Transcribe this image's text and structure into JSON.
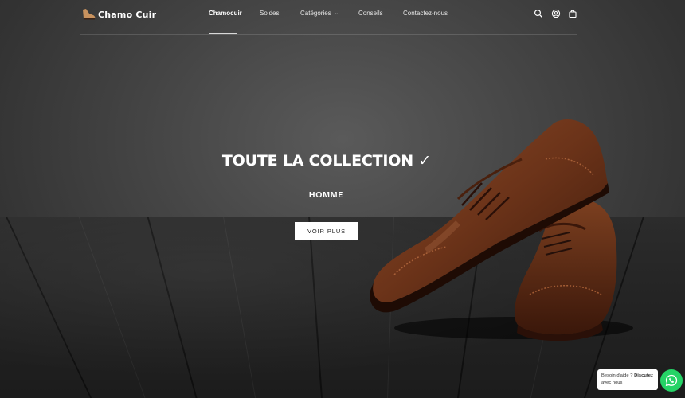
{
  "brand": {
    "name": "Chamo Cuir"
  },
  "nav": {
    "items": [
      {
        "label": "Chamocuir",
        "active": true
      },
      {
        "label": "Soldes"
      },
      {
        "label": "Catégories",
        "has_dropdown": true
      },
      {
        "label": "Conseils"
      },
      {
        "label": "Contactez-nous"
      }
    ],
    "icons": [
      "search-icon",
      "account-icon",
      "cart-icon"
    ]
  },
  "hero": {
    "title": "TOUTE LA COLLECTION ✓",
    "subtitle": "HOMME",
    "button_label": "VOIR PLUS"
  },
  "chat": {
    "text_1": "Besoin d'aide ? ",
    "text_2": "Discutez",
    "text_3": "avec nous",
    "button_icon": "whatsapp-icon",
    "color": "#25d366"
  }
}
